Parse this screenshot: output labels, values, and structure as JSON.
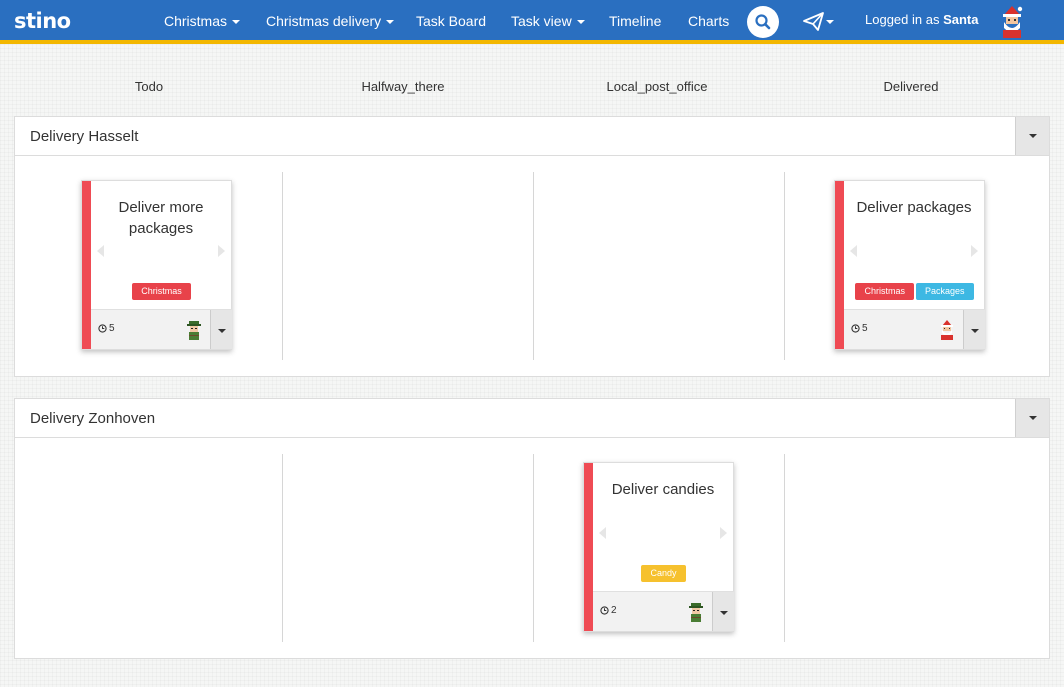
{
  "app": {
    "logo": "stino"
  },
  "nav": {
    "items": [
      {
        "label": "Christmas",
        "dropdown": true
      },
      {
        "label": "Christmas delivery",
        "dropdown": true
      },
      {
        "label": "Task Board",
        "dropdown": false
      },
      {
        "label": "Task view",
        "dropdown": true
      },
      {
        "label": "Timeline",
        "dropdown": false
      },
      {
        "label": "Charts",
        "dropdown": false
      }
    ],
    "search_icon": "search-icon",
    "send_icon": "paper-plane-icon",
    "login_prefix": "Logged in as",
    "user_name": "Santa",
    "user_avatar": "santa-avatar"
  },
  "columns": [
    "Todo",
    "Halfway_there",
    "Local_post_office",
    "Delivered"
  ],
  "lanes": [
    {
      "title": "Delivery Hasselt",
      "cards": [
        {
          "column": "Todo",
          "title": "Deliver more packages",
          "tags": [
            {
              "label": "Christmas",
              "color": "#e8424a"
            }
          ],
          "estimate": "5",
          "assignee": "elf-avatar"
        },
        {
          "column": "Delivered",
          "title": "Deliver packages",
          "tags": [
            {
              "label": "Christmas",
              "color": "#e8424a"
            },
            {
              "label": "Packages",
              "color": "#3db8e3"
            }
          ],
          "estimate": "5",
          "assignee": "santa-avatar"
        }
      ]
    },
    {
      "title": "Delivery Zonhoven",
      "cards": [
        {
          "column": "Local_post_office",
          "title": "Deliver candies",
          "tags": [
            {
              "label": "Candy",
              "color": "#f6c12e"
            }
          ],
          "estimate": "2",
          "assignee": "elf-avatar"
        }
      ]
    }
  ],
  "colors": {
    "navbar": "#2a6fc0",
    "navbar_border": "#f3b700",
    "card_stripe": "#ef4b54"
  }
}
